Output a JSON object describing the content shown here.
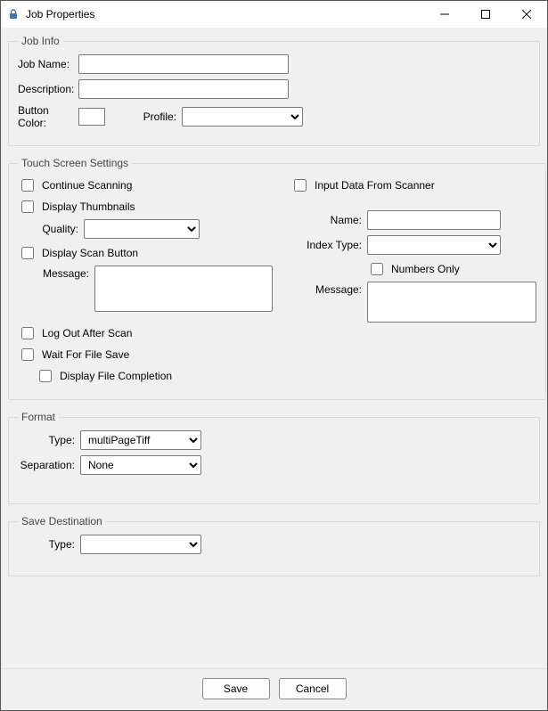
{
  "window": {
    "title": "Job Properties"
  },
  "jobInfo": {
    "legend": "Job Info",
    "jobNameLabel": "Job Name:",
    "jobName": "",
    "descriptionLabel": "Description:",
    "description": "",
    "buttonColorLabel": "Button Color:",
    "profileLabel": "Profile:",
    "profile": ""
  },
  "touch": {
    "legend": "Touch Screen Settings",
    "continueScanning": "Continue Scanning",
    "displayThumbnails": "Display Thumbnails",
    "qualityLabel": "Quality:",
    "quality": "",
    "displayScanButton": "Display Scan Button",
    "scanMessageLabel": "Message:",
    "scanMessage": "",
    "logOutAfterScan": "Log Out After Scan",
    "waitForFileSave": "Wait For File Save",
    "displayFileCompletion": "Display File Completion",
    "inputDataFromScanner": "Input Data From Scanner",
    "nameLabel": "Name:",
    "name": "",
    "indexTypeLabel": "Index Type:",
    "indexType": "",
    "numbersOnly": "Numbers Only",
    "inputMessageLabel": "Message:",
    "inputMessage": ""
  },
  "format": {
    "legend": "Format",
    "typeLabel": "Type:",
    "type": "multiPageTiff",
    "separationLabel": "Separation:",
    "separation": "None"
  },
  "saveDest": {
    "legend": "Save Destination",
    "typeLabel": "Type:",
    "type": ""
  },
  "buttons": {
    "save": "Save",
    "cancel": "Cancel"
  }
}
